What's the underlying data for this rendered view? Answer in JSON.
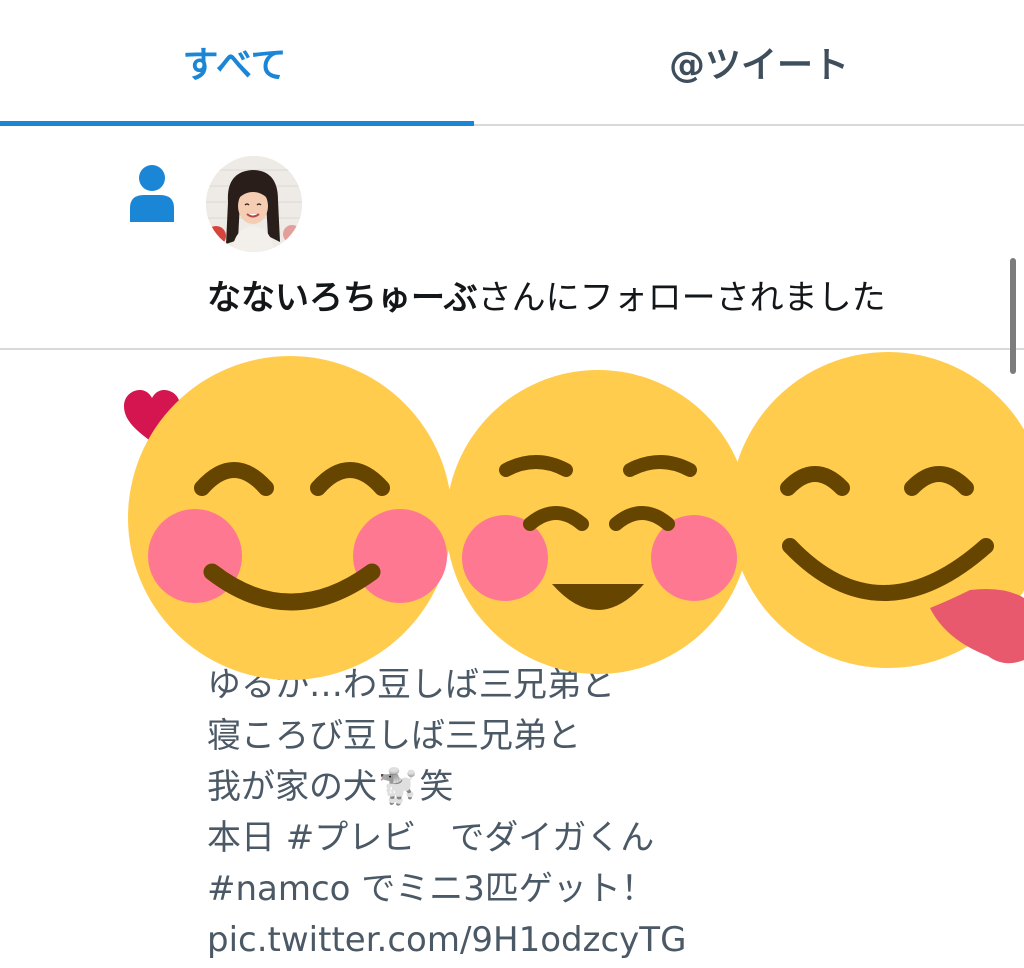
{
  "tabs": [
    {
      "label": "すべて",
      "active": true
    },
    {
      "label": "@ツイート",
      "active": false
    }
  ],
  "colors": {
    "accent": "#1b86d6",
    "heart": "#d5154f",
    "emoji_face": "#ffcc4d",
    "emoji_blush": "#ff7892",
    "emoji_features": "#664500",
    "tongue": "#e8596e"
  },
  "follow_notification": {
    "icon": "person-icon",
    "user_name": "なないろちゅーぶ",
    "action_text": "さんにフォローされました"
  },
  "like_notification": {
    "icon": "heart-icon",
    "emojis": [
      "smiling-face-with-smiling-eyes",
      "smiling-face-with-open-mouth-and-smiling-eyes",
      "face-savoring-food"
    ],
    "tweet_lines": [
      "ゆるか…わ豆しば三兄弟と",
      "寝ころび豆しば三兄弟と",
      "我が家の犬🐩笑",
      "本日 #プレビ　でダイガくん",
      "#namco  でミニ3匹ゲット！",
      "pic.twitter.com/9H1odzcyTG"
    ]
  }
}
